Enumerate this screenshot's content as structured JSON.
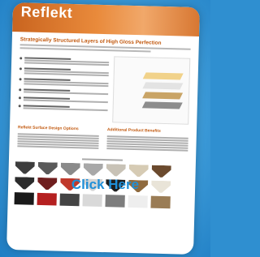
{
  "brand": "Reflekt",
  "headline": "Strategically Structured Layers of High Gloss Perfection",
  "sections": {
    "left_title": "Reflekt Surface Design Options",
    "right_title": "Additional Product Benefits"
  },
  "cta_label": "Click Here",
  "colors": {
    "accent": "#c25a10",
    "cta": "#1f8fd8",
    "background": "#2f8fd0"
  },
  "swatch_colors_row1": [
    "#3d3d3d",
    "#5a5a5a",
    "#8a8a8a",
    "#a8a8a8",
    "#c8c2b6",
    "#d6cbb4",
    "#6b4a2e"
  ],
  "swatch_colors_row2": [
    "#2b2b2b",
    "#6f1f1f",
    "#c0392b",
    "#d4d4d4",
    "#1e1e1e",
    "#8f6a3e",
    "#e9e4d8"
  ],
  "swatch_colors_row3": [
    "#1a1a1a",
    "#b52020",
    "#444",
    "#d9d9d9",
    "#7d7d7d",
    "#eee",
    "#9a7c55"
  ]
}
